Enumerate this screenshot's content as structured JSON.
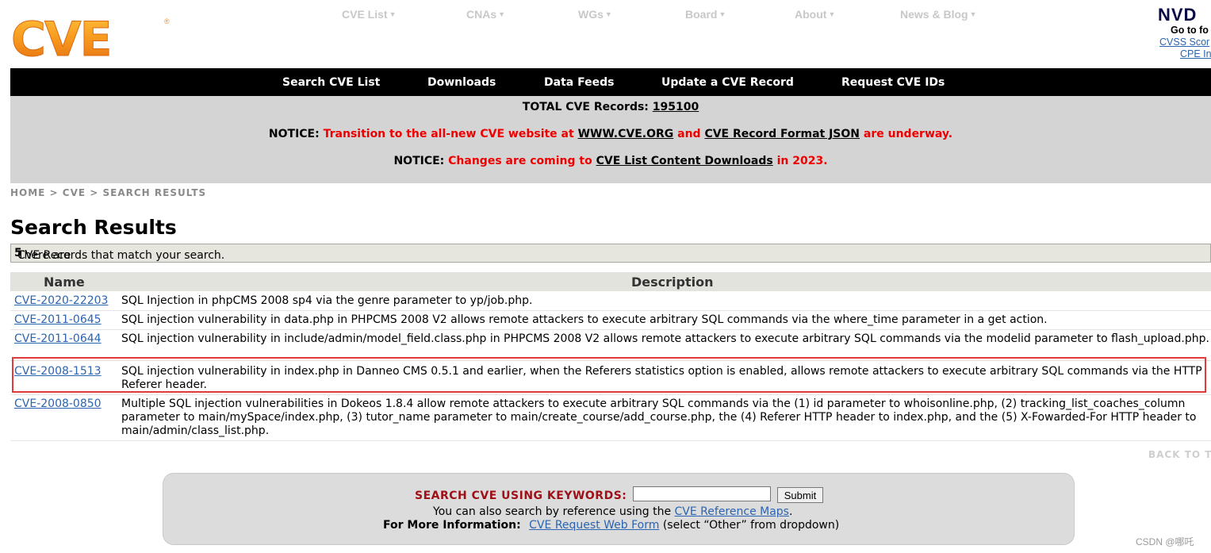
{
  "logo": {
    "text": "CVE",
    "trademark": "®"
  },
  "top_nav": [
    {
      "label": "CVE List"
    },
    {
      "label": "CNAs"
    },
    {
      "label": "WGs"
    },
    {
      "label": "Board"
    },
    {
      "label": "About"
    },
    {
      "label": "News & Blog"
    }
  ],
  "nvd": {
    "logo": "NVD",
    "goto": "Go to fo",
    "link1": "CVSS Scor",
    "link2": "CPE In"
  },
  "main_nav": [
    {
      "label": "Search CVE List"
    },
    {
      "label": "Downloads"
    },
    {
      "label": "Data Feeds"
    },
    {
      "label": "Update a CVE Record"
    },
    {
      "label": "Request CVE IDs"
    }
  ],
  "notice": {
    "total_label": "TOTAL CVE Records:",
    "total_value": "195100",
    "n1_label": "NOTICE:",
    "n1_a": "Transition to the all-new CVE website at",
    "n1_link1": "WWW.CVE.ORG",
    "n1_b": "and",
    "n1_link2": "CVE Record Format JSON",
    "n1_c": "are underway.",
    "n2_label": "NOTICE:",
    "n2_a": "Changes are coming to",
    "n2_link": "CVE List Content Downloads",
    "n2_b": "in 2023."
  },
  "breadcrumb": "HOME > CVE > SEARCH RESULTS",
  "page_title": "Search Results",
  "match": {
    "prefix": "There are",
    "count": "5",
    "suffix": "CVE Records that match your search."
  },
  "table": {
    "headers": [
      "Name",
      "Description"
    ],
    "rows": [
      {
        "id": "CVE-2020-22203",
        "desc": "SQL Injection in phpCMS 2008 sp4 via the genre parameter to yp/job.php."
      },
      {
        "id": "CVE-2011-0645",
        "desc": "SQL injection vulnerability in data.php in PHPCMS 2008 V2 allows remote attackers to execute arbitrary SQL commands via the where_time parameter in a get action."
      },
      {
        "id": "CVE-2011-0644",
        "desc": "SQL injection vulnerability in include/admin/model_field.class.php in PHPCMS 2008 V2 allows remote attackers to execute arbitrary SQL commands via the modelid parameter to flash_upload.php."
      },
      {
        "id": "CVE-2008-1513",
        "desc": "SQL injection vulnerability in index.php in Danneo CMS 0.5.1 and earlier, when the Referers statistics option is enabled, allows remote attackers to execute arbitrary SQL commands via the HTTP Referer header."
      },
      {
        "id": "CVE-2008-0850",
        "desc": "Multiple SQL injection vulnerabilities in Dokeos 1.8.4 allow remote attackers to execute arbitrary SQL commands via the (1) id parameter to whoisonline.php, (2) tracking_list_coaches_column parameter to main/mySpace/index.php, (3) tutor_name parameter to main/create_course/add_course.php, the (4) Referer HTTP header to index.php, and the (5) X-Fowarded-For HTTP header to main/admin/class_list.php."
      }
    ]
  },
  "back_to_top": "BACK TO TO",
  "search_box": {
    "keyword_label": "SEARCH CVE USING KEYWORDS:",
    "input_value": "",
    "submit_label": "Submit",
    "ref_prefix": "You can also search by reference using the",
    "ref_link": "CVE Reference Maps",
    "ref_suffix": ".",
    "more_label": "For More Information:",
    "more_link": "CVE Request Web Form",
    "more_suffix": "(select “Other” from dropdown)"
  },
  "watermark": "CSDN @哪吒"
}
